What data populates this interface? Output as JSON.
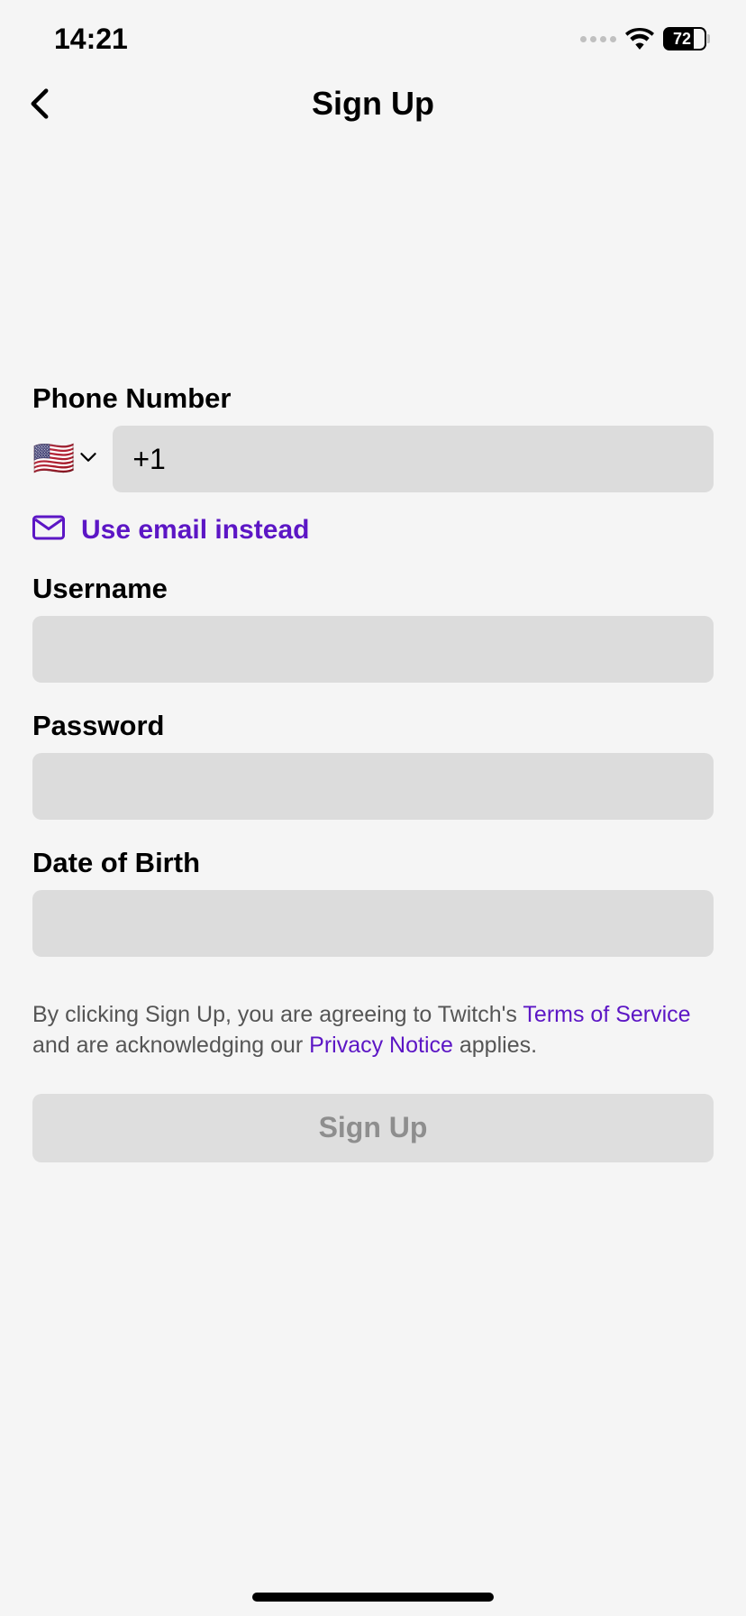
{
  "status_bar": {
    "time": "14:21",
    "battery_percent": "72"
  },
  "nav": {
    "title": "Sign Up"
  },
  "form": {
    "phone_label": "Phone Number",
    "country_flag": "🇺🇸",
    "phone_value": "+1",
    "email_link": "Use email instead",
    "username_label": "Username",
    "username_value": "",
    "password_label": "Password",
    "password_value": "",
    "dob_label": "Date of Birth",
    "dob_value": ""
  },
  "legal": {
    "prefix": "By clicking Sign Up, you are agreeing to Twitch's ",
    "tos": "Terms of Service",
    "middle": " and are acknowledging our ",
    "privacy": "Privacy Notice",
    "suffix": " applies."
  },
  "signup_button_label": "Sign Up",
  "colors": {
    "accent": "#5c16c5",
    "input_bg": "#dcdcdc"
  }
}
